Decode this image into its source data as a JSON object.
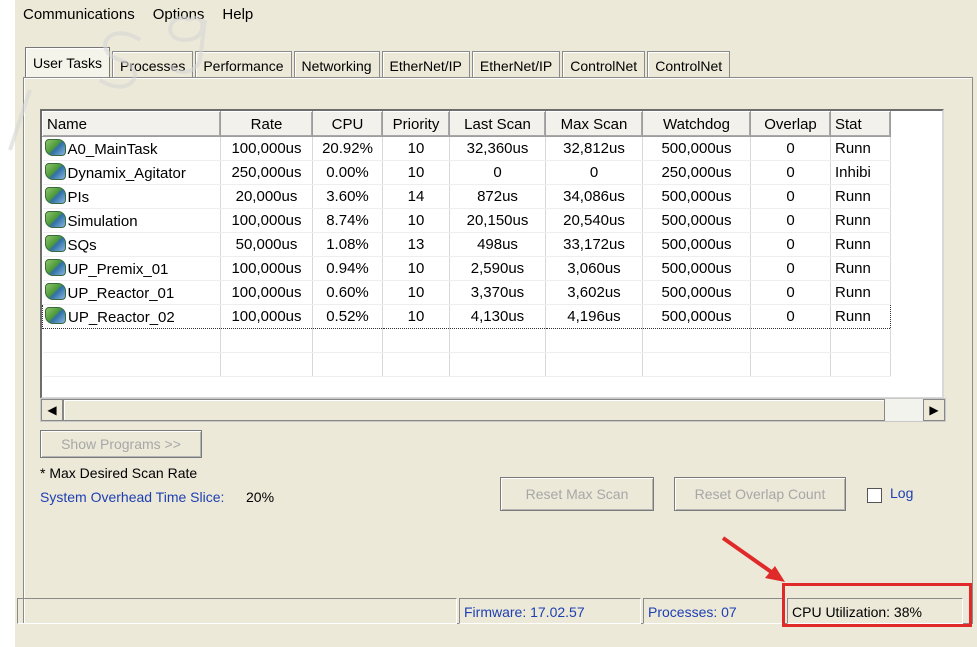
{
  "menu": [
    "Communications",
    "Options",
    "Help"
  ],
  "tabs": [
    "User Tasks",
    "Processes",
    "Performance",
    "Networking",
    "EtherNet/IP",
    "EtherNet/IP",
    "ControlNet",
    "ControlNet"
  ],
  "active_tab": "User Tasks",
  "table": {
    "columns": [
      "Name",
      "Rate",
      "CPU",
      "Priority",
      "Last Scan",
      "Max Scan",
      "Watchdog",
      "Overlap",
      "Stat"
    ],
    "rows": [
      {
        "name": "A0_MainTask",
        "rate": "100,000us",
        "cpu": "20.92%",
        "priority": "10",
        "last": "32,360us",
        "max": "32,812us",
        "watchdog": "500,000us",
        "overlap": "0",
        "status": "Runn"
      },
      {
        "name": "Dynamix_Agitator",
        "rate": "250,000us",
        "cpu": "0.00%",
        "priority": "10",
        "last": "0",
        "max": "0",
        "watchdog": "250,000us",
        "overlap": "0",
        "status": "Inhibi"
      },
      {
        "name": "PIs",
        "rate": "20,000us",
        "cpu": "3.60%",
        "priority": "14",
        "last": "872us",
        "max": "34,086us",
        "watchdog": "500,000us",
        "overlap": "0",
        "status": "Runn"
      },
      {
        "name": "Simulation",
        "rate": "100,000us",
        "cpu": "8.74%",
        "priority": "10",
        "last": "20,150us",
        "max": "20,540us",
        "watchdog": "500,000us",
        "overlap": "0",
        "status": "Runn"
      },
      {
        "name": "SQs",
        "rate": "50,000us",
        "cpu": "1.08%",
        "priority": "13",
        "last": "498us",
        "max": "33,172us",
        "watchdog": "500,000us",
        "overlap": "0",
        "status": "Runn"
      },
      {
        "name": "UP_Premix_01",
        "rate": "100,000us",
        "cpu": "0.94%",
        "priority": "10",
        "last": "2,590us",
        "max": "3,060us",
        "watchdog": "500,000us",
        "overlap": "0",
        "status": "Runn"
      },
      {
        "name": "UP_Reactor_01",
        "rate": "100,000us",
        "cpu": "0.60%",
        "priority": "10",
        "last": "3,370us",
        "max": "3,602us",
        "watchdog": "500,000us",
        "overlap": "0",
        "status": "Runn"
      },
      {
        "name": "UP_Reactor_02",
        "rate": "100,000us",
        "cpu": "0.52%",
        "priority": "10",
        "last": "4,130us",
        "max": "4,196us",
        "watchdog": "500,000us",
        "overlap": "0",
        "status": "Runn"
      }
    ]
  },
  "buttons": {
    "show_programs": "Show Programs >>",
    "reset_max_scan": "Reset Max Scan",
    "reset_overlap": "Reset Overlap Count"
  },
  "log_label": "Log",
  "footnote": "* Max Desired Scan Rate",
  "overhead_label": "System Overhead Time Slice:",
  "overhead_value": "20%",
  "statusbar": {
    "firmware": "Firmware: 17.02.57",
    "processes": "Processes: 07",
    "cpu_util": "CPU Utilization: 38%"
  },
  "colors": {
    "highlight": "#e02a2a",
    "link_blue": "#1d3fb3"
  }
}
